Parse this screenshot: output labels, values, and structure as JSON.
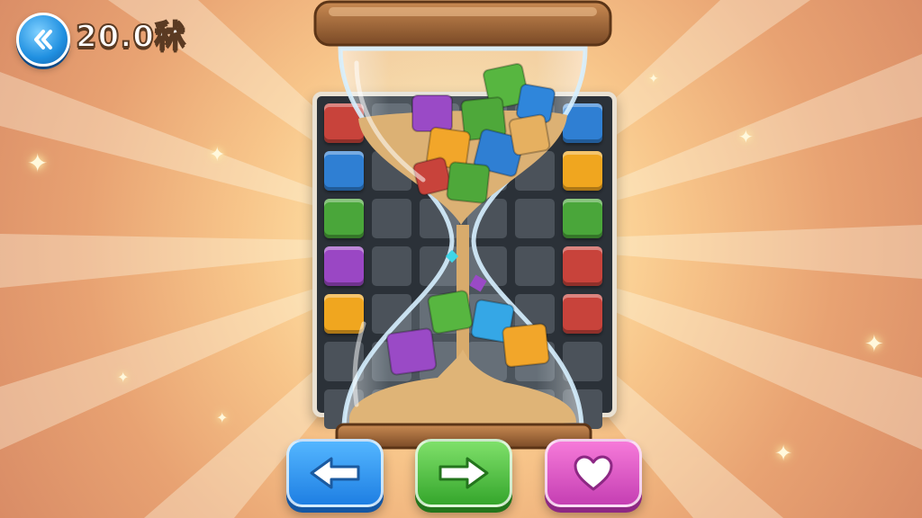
{
  "hud": {
    "timer_text": "20.0",
    "timer_unit": "秫",
    "back_icon": "double-chevron-left-icon"
  },
  "board": {
    "left_column_tiles": [
      "red",
      "blue",
      "green",
      "purple",
      "yellow"
    ],
    "right_column_tiles": [
      "blue",
      "yellow",
      "green",
      "red",
      "red"
    ]
  },
  "colors": {
    "red": "#c8433b",
    "blue": "#2f7fd3",
    "green": "#4aa63a",
    "purple": "#9a47c4",
    "yellow": "#f0a61f",
    "sand": "#e2b77a",
    "wood": "#9c6436"
  },
  "controls": {
    "back_icon": "arrow-left-icon",
    "next_icon": "arrow-right-icon",
    "heart_icon": "heart-icon"
  }
}
